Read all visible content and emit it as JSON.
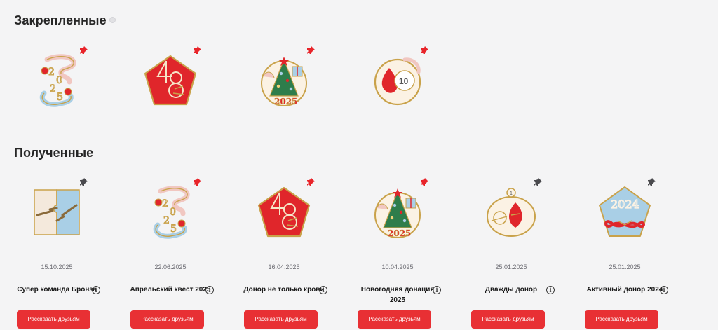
{
  "sections": {
    "pinned_title": "Закрепленные",
    "received_title": "Полученные"
  },
  "colors": {
    "accent": "#e83034",
    "pin_active": "#e8242a",
    "pin_inactive": "#4a4a4e",
    "gold": "#c9a24a",
    "red": "#e0262b",
    "sky": "#a9cfe6"
  },
  "pinned": [
    {
      "badge_icon": "badge-2025-icon",
      "pinned": true
    },
    {
      "badge_icon": "badge-48-pentagon-icon",
      "pinned": true
    },
    {
      "badge_icon": "badge-christmas-tree-icon",
      "pinned": true
    },
    {
      "badge_icon": "badge-10-drop-icon",
      "pinned": true
    }
  ],
  "received": [
    {
      "badge_icon": "badge-puzzle-icon",
      "pinned": false,
      "date": "15.10.2025",
      "name": "Супер команда Бронза",
      "share_label": "Рассказать друзьям"
    },
    {
      "badge_icon": "badge-2025-icon",
      "pinned": true,
      "date": "22.06.2025",
      "name": "Апрельский квест 2025",
      "share_label": "Рассказать друзьям"
    },
    {
      "badge_icon": "badge-48-pentagon-icon",
      "pinned": true,
      "date": "16.04.2025",
      "name": "Донор не только крови",
      "share_label": "Рассказать друзьям"
    },
    {
      "badge_icon": "badge-christmas-tree-icon",
      "pinned": true,
      "date": "10.04.2025",
      "name": "Новогодняя донация 2025",
      "share_label": "Рассказать друзьям"
    },
    {
      "badge_icon": "badge-heart-drop-icon",
      "pinned": false,
      "date": "25.01.2025",
      "name": "Дважды донор",
      "share_label": "Рассказать друзьям"
    },
    {
      "badge_icon": "badge-2024-infinity-icon",
      "pinned": false,
      "date": "25.01.2025",
      "name": "Активный донор 2024",
      "share_label": "Рассказать друзьям"
    }
  ]
}
